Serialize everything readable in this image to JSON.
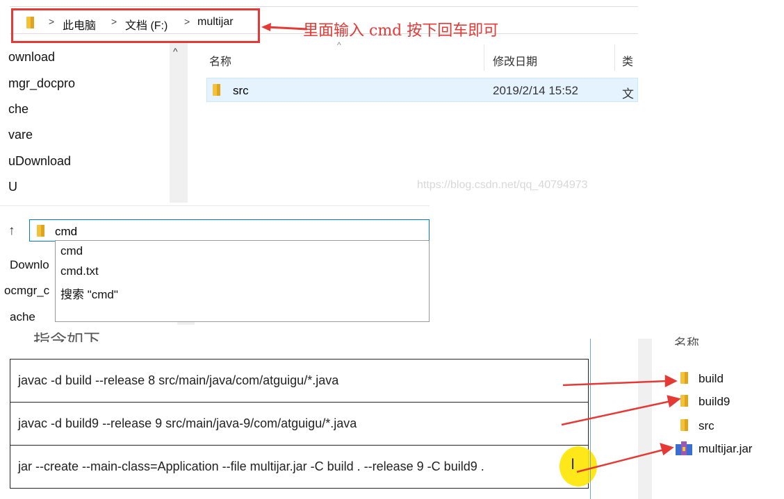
{
  "explorer": {
    "breadcrumb": [
      "此电脑",
      "文档 (F:)",
      "multijar"
    ],
    "annotation": "里面输入 cmd 按下回车即可",
    "nav_items": [
      "ownload",
      "mgr_docpro",
      "che",
      "vare",
      "uDownload",
      "U"
    ],
    "columns": {
      "name": "名称",
      "modified": "修改日期",
      "type": "类"
    },
    "file": {
      "name": "src",
      "modified": "2019/2/14 15:52",
      "type": "文"
    },
    "watermark": "https://blog.csdn.net/qq_40794973"
  },
  "address2": {
    "value": "cmd",
    "suggestions": [
      "cmd",
      "cmd.txt",
      "搜索 \"cmd\""
    ],
    "nav_items": [
      "Downlo",
      "ocmgr_c",
      "ache"
    ]
  },
  "commands": {
    "partial_heading": "指令如下",
    "lines": [
      "javac -d build --release 8 src/main/java/com/atguigu/*.java",
      "javac -d build9 --release 9 src/main/java-9/com/atguigu/*.java",
      "jar --create --main-class=Application --file multijar.jar -C build . --release 9 -C build9 ."
    ]
  },
  "result_pane": {
    "header": "名称",
    "items": [
      "build",
      "build9",
      "src",
      "multijar.jar"
    ]
  },
  "colors": {
    "highlight_red": "#e53935",
    "folder_yellow": "#f2c23a",
    "cursor_yellow": "#ffe600"
  }
}
